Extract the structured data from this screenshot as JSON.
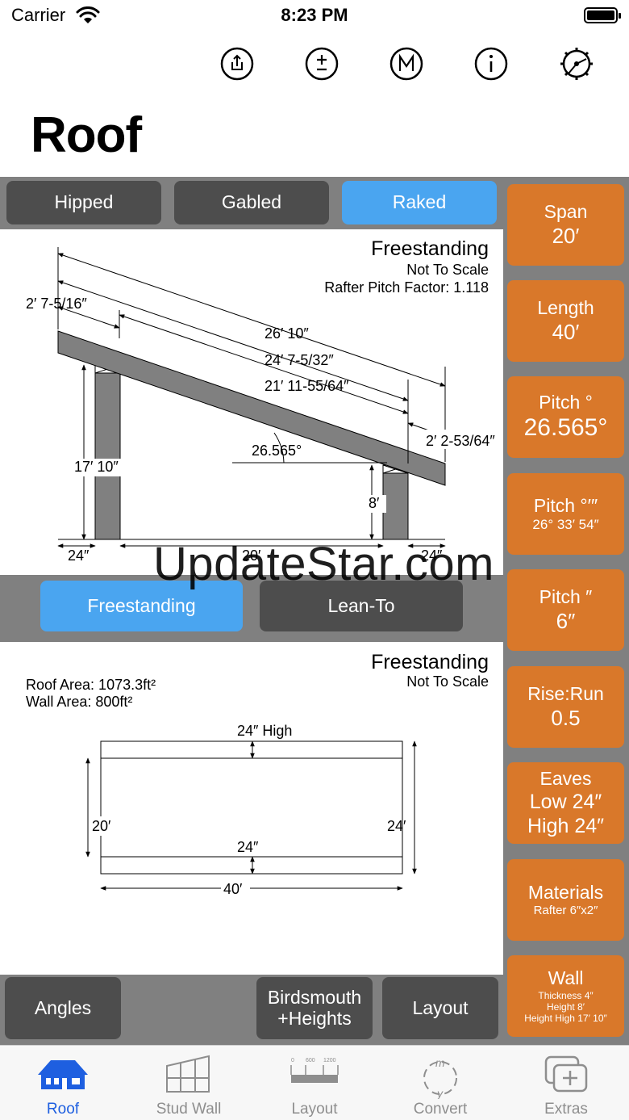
{
  "status_bar": {
    "carrier": "Carrier",
    "time": "8:23 PM"
  },
  "toolbar": {
    "icons": [
      "share-icon",
      "plus-minus-icon",
      "m-icon",
      "info-icon",
      "gear-icon"
    ]
  },
  "page_title": "Roof",
  "roof_types": [
    {
      "label": "Hipped",
      "active": false
    },
    {
      "label": "Gabled",
      "active": false
    },
    {
      "label": "Raked",
      "active": true
    }
  ],
  "elevation": {
    "title": "Freestanding",
    "subtitle": "Not To Scale",
    "factor": "Rafter Pitch Factor: 1.118",
    "dim_overhang": "2′ 7-5/16″",
    "dim_rafter_total": "26′ 10″",
    "dim_rafter_top": "24′ 7-5/32″",
    "dim_rafter_span": "21′ 11-55/64″",
    "dim_lower_overhang": "2′ 2-53/64″",
    "angle": "26.565°",
    "high_wall": "17′ 10″",
    "low_wall": "8′",
    "eave_left": "24″",
    "span": "20′",
    "eave_right": "24″"
  },
  "structure_types": [
    {
      "label": "Freestanding",
      "active": true
    },
    {
      "label": "Lean-To",
      "active": false
    }
  ],
  "plan": {
    "title": "Freestanding",
    "subtitle": "Not To Scale",
    "roof_area": "Roof Area: 1073.3ft²",
    "wall_area": "Wall Area: 800ft²",
    "top_eave": "24″ High",
    "bottom_eave": "24″",
    "left_dim": "20′",
    "right_dim": "24′",
    "bottom_dim": "40′"
  },
  "bottom_buttons": {
    "angles": "Angles",
    "birdsmouth": "Birdsmouth +Heights",
    "layout": "Layout"
  },
  "side_buttons": {
    "span": {
      "label": "Span",
      "value": "20′"
    },
    "length": {
      "label": "Length",
      "value": "40′"
    },
    "pitch_deg": {
      "label": "Pitch °",
      "value": "26.565°"
    },
    "pitch_dms": {
      "label": "Pitch °′″",
      "value": "26° 33′ 54″"
    },
    "pitch_in": {
      "label": "Pitch ″",
      "value": "6″"
    },
    "rise_run": {
      "label": "Rise:Run",
      "value": "0.5"
    },
    "eaves": {
      "label": "Eaves",
      "low": "Low 24″",
      "high": "High 24″"
    },
    "materials": {
      "label": "Materials",
      "value": "Rafter 6″x2″"
    },
    "wall": {
      "label": "Wall",
      "thickness": "Thickness 4″",
      "height": "Height 8′",
      "height_high": "Height High 17′ 10″"
    }
  },
  "tabs": [
    {
      "label": "Roof",
      "active": true
    },
    {
      "label": "Stud Wall",
      "active": false
    },
    {
      "label": "Layout",
      "active": false
    },
    {
      "label": "Convert",
      "active": false
    },
    {
      "label": "Extras",
      "active": false
    }
  ],
  "layout_icon_ticks": [
    "0",
    "600",
    "1200"
  ],
  "convert_icon_letters": {
    "m": "m",
    "y": "y"
  },
  "watermark": "UpdateStar.com",
  "colors": {
    "orange": "#d9782a",
    "blue": "#4aa5f0",
    "dark_button": "#4d4d4d",
    "panel_bg": "#808080",
    "tab_active": "#1e5fe0"
  }
}
